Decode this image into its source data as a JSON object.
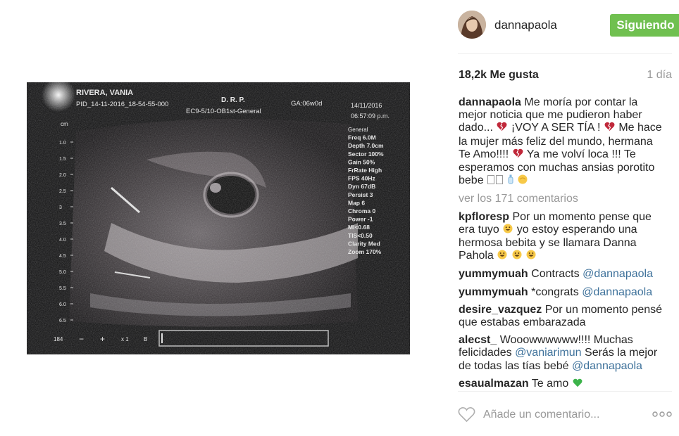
{
  "post": {
    "username": "dannapaola",
    "follow_label": "Siguiendo",
    "likes": "18,2k Me gusta",
    "time": "1 día",
    "caption": {
      "user": "dannapaola",
      "p1": "Me moría por contar la mejor noticia que me pudieron haber dado...",
      "p2": "¡VOY A SER TÍA !",
      "p3": "Me hace la mujer más feliz del mundo, hermana Te Amo!!!!",
      "p4": "Ya me volví loca !!! Te esperamos con muchas ansias porotito bebe"
    },
    "view_comments": "ver los 171 comentarios",
    "comments": [
      {
        "user": "kpfloresp",
        "t1": "Por un momento pense que era tuyo",
        "t2": "yo estoy esperando una hermosa bebita y se llamara Danna Pahola"
      },
      {
        "user": "yummymuah",
        "t1": "Contracts",
        "mention": "@dannapaola"
      },
      {
        "user": "yummymuah",
        "t1": "*congrats",
        "mention": "@dannapaola"
      },
      {
        "user": "desire_vazquez",
        "t1": "Por un momento pensé que estabas embarazada"
      },
      {
        "user": "alecst_",
        "t1": "Wooowwwwww!!!! Muchas felicidades",
        "mention1": "@vaniarimun",
        "t2": "Serás la mejor de todas las tías bebé",
        "mention2": "@dannapaola"
      },
      {
        "user": "esaualmazan",
        "t1": "Te amo"
      }
    ],
    "add_comment_placeholder": "Añade un comentario..."
  },
  "ultrasound": {
    "name": "RIVERA, VANIA",
    "pid": "PID_14-11-2016_18-54-55-000",
    "drp": "D.  R.  P.",
    "probe": "EC9-5/10-OB1st-General",
    "ga": "GA:06w0d",
    "date": "14/11/2016",
    "clock": "06:57:09 p.m.",
    "params": [
      "General",
      "Freq 6.0M",
      "Depth 7.0cm",
      "Sector 100%",
      "Gain 50%",
      "FrRate High",
      "FPS 40Hz",
      "Dyn 67dB",
      "Persist 3",
      "Map 6",
      "Chroma 0",
      "Power -1",
      "MI<0.68",
      "TIS<0.50",
      "Clarity Med",
      "Zoom 170%"
    ],
    "depth_unit": "cm",
    "depth_ticks": [
      "1.0",
      "1.5",
      "2.0",
      "2.5",
      "3",
      "3.5",
      "4.0",
      "4.5",
      "5.0",
      "5.5",
      "6.0",
      "6.5"
    ],
    "bottom": {
      "frame": "184",
      "minus": "−",
      "plus": "+",
      "mult": "x 1",
      "b": "B"
    }
  },
  "colors": {
    "follow_bg": "#70c050",
    "mention": "#3f729b",
    "muted": "#999999",
    "text": "#262626"
  },
  "icons": [
    "heart-icon",
    "more-options-icon",
    "broken-heart-icon",
    "blue-heart-icon",
    "grinning-face-icon",
    "green-heart-icon"
  ]
}
